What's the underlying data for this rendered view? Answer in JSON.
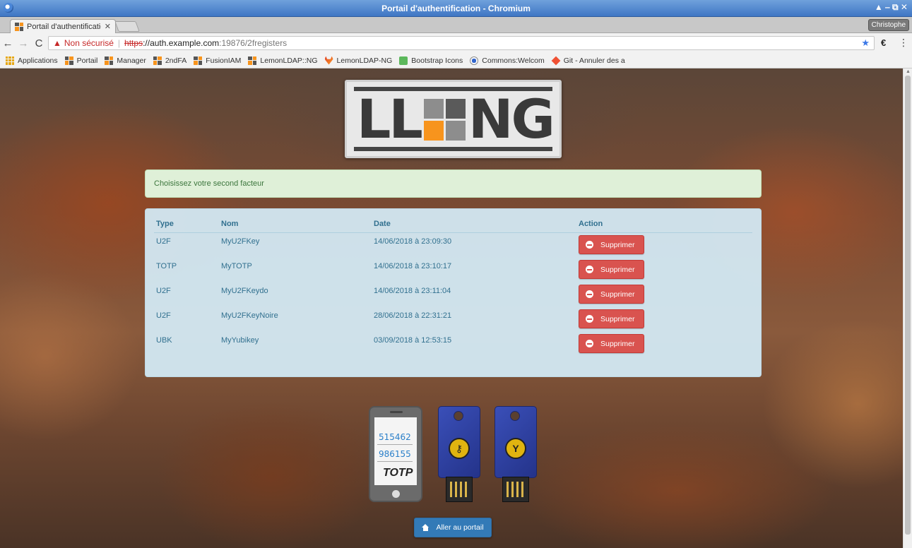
{
  "window": {
    "title": "Portail d'authentification - Chromium",
    "controls": "▲ ‒ ⧉ ✕"
  },
  "tab": {
    "title": "Portail d'authentificatio",
    "close": "✕"
  },
  "profile": "Christophe",
  "address_bar": {
    "warning": "Non sécurisé",
    "scheme": "https",
    "host": "://auth.example.com",
    "rest": ":19876/2fregisters"
  },
  "bookmarks": [
    {
      "label": "Applications",
      "icon": "apps-icon"
    },
    {
      "label": "Portail",
      "icon": "lemonldap-icon"
    },
    {
      "label": "Manager",
      "icon": "lemonldap-icon"
    },
    {
      "label": "2ndFA",
      "icon": "lemonldap-icon"
    },
    {
      "label": "FusionIAM",
      "icon": "lemonldap-icon"
    },
    {
      "label": "LemonLDAP::NG",
      "icon": "lemonldap-icon"
    },
    {
      "label": "LemonLDAP-NG",
      "icon": "gitlab-icon"
    },
    {
      "label": "Bootstrap Icons",
      "icon": "bootstrap-icon"
    },
    {
      "label": "Commons:Welcom",
      "icon": "wikimedia-icon"
    },
    {
      "label": "Git - Annuler des a",
      "icon": "git-icon"
    }
  ],
  "logo": {
    "left": "LL",
    "right": "NG"
  },
  "alert": "Choisissez votre second facteur",
  "table": {
    "headers": {
      "type": "Type",
      "name": "Nom",
      "date": "Date",
      "action": "Action"
    },
    "rows": [
      {
        "type": "U2F",
        "name": "MyU2FKey",
        "date": "14/06/2018 à 23:09:30",
        "action": "Supprimer"
      },
      {
        "type": "TOTP",
        "name": "MyTOTP",
        "date": "14/06/2018 à 23:10:17",
        "action": "Supprimer"
      },
      {
        "type": "U2F",
        "name": "MyU2FKeydo",
        "date": "14/06/2018 à 23:11:04",
        "action": "Supprimer"
      },
      {
        "type": "U2F",
        "name": "MyU2FKeyNoire",
        "date": "28/06/2018 à 22:31:21",
        "action": "Supprimer"
      },
      {
        "type": "UBK",
        "name": "MyYubikey",
        "date": "03/09/2018 à 12:53:15",
        "action": "Supprimer"
      }
    ]
  },
  "illustration": {
    "codes": [
      "515462",
      "986155"
    ],
    "totp_label": "TOTP"
  },
  "portal_button": "Aller au portail",
  "colors": {
    "alert_bg": "#dff0d8",
    "panel_bg": "#d4ecf7",
    "danger": "#d9534f",
    "primary": "#337ab7",
    "lemonldap_orange": "#f7941d"
  }
}
